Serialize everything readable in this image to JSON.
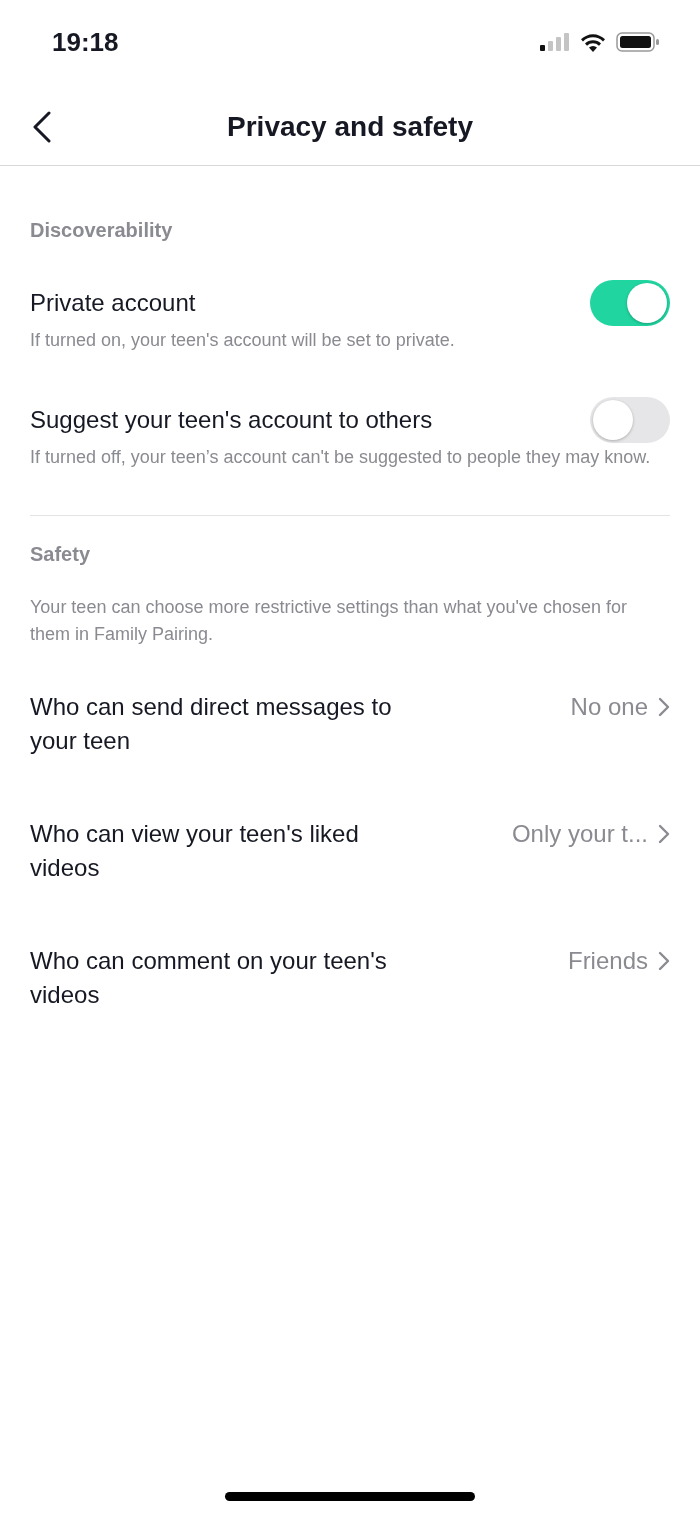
{
  "status_bar": {
    "time": "19:18"
  },
  "header": {
    "title": "Privacy and safety"
  },
  "sections": [
    {
      "title": "Discoverability",
      "items": [
        {
          "kind": "toggle",
          "label": "Private account",
          "on": true,
          "description": "If turned on, your teen's account will be set to private."
        },
        {
          "kind": "toggle",
          "label": "Suggest your teen's account to others",
          "on": false,
          "description": "If turned off, your teen’s account can't be suggested to people they may know."
        }
      ]
    },
    {
      "title": "Safety",
      "note": "Your teen can choose more restrictive settings than what you've chosen for them in Family Pairing.",
      "items": [
        {
          "kind": "link",
          "label": "Who can send direct messages to your teen",
          "value": "No one"
        },
        {
          "kind": "link",
          "label": "Who can view your teen's liked videos",
          "value": "Only your t..."
        },
        {
          "kind": "link",
          "label": "Who can comment on your teen's videos",
          "value": "Friends"
        }
      ]
    }
  ]
}
